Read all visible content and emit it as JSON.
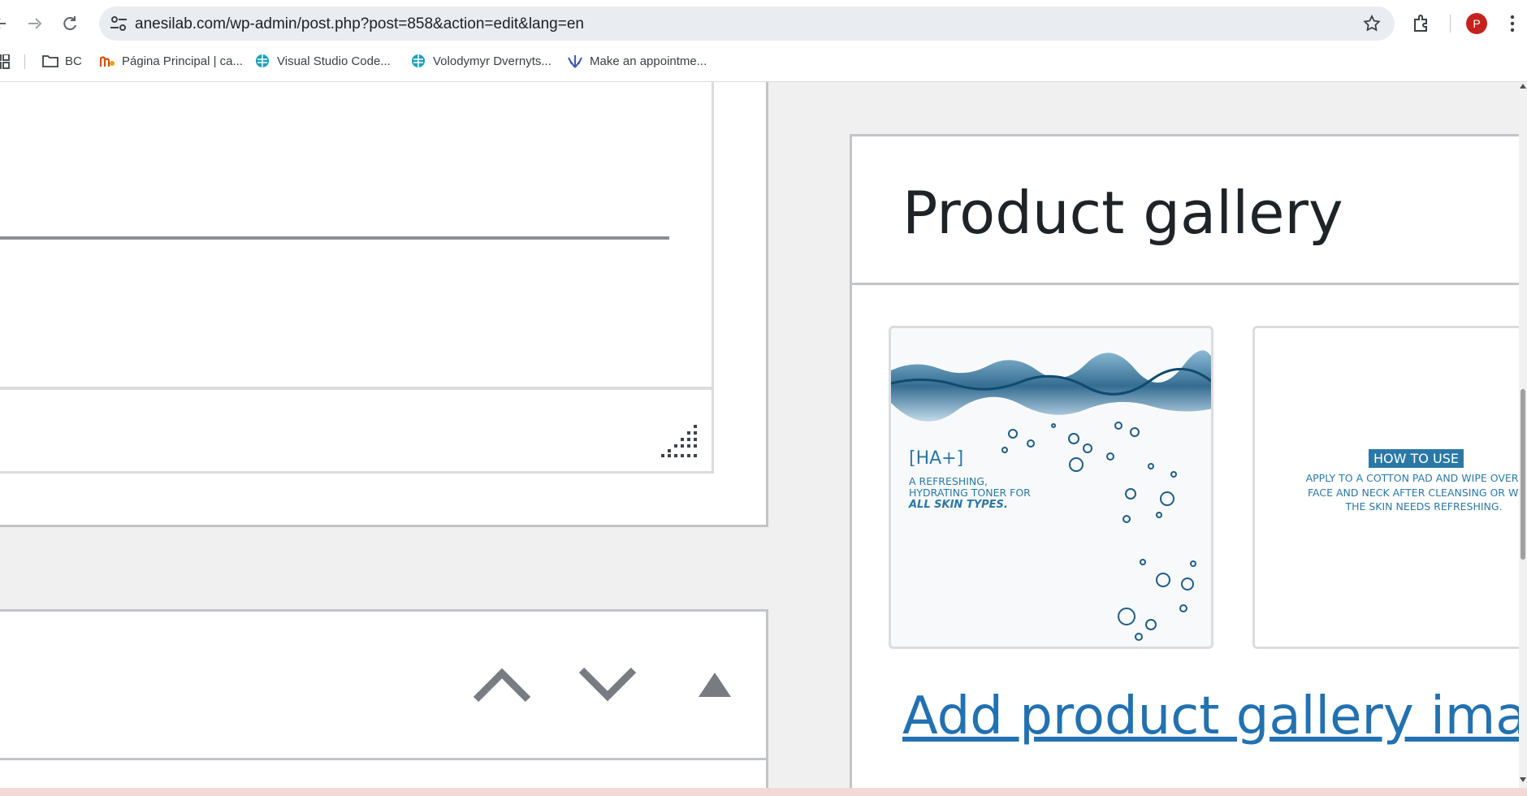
{
  "browser": {
    "url": "anesilab.com/wp-admin/post.php?post=858&action=edit&lang=en",
    "avatar_letter": "P",
    "bookmarks": [
      {
        "label": "BC",
        "icon": "folder-icon"
      },
      {
        "label": "Página Principal | ca...",
        "icon": "site-icon"
      },
      {
        "label": "Visual Studio Code...",
        "icon": "teal-globe-icon"
      },
      {
        "label": "Volodymyr Dvernyts...",
        "icon": "teal-globe-icon"
      },
      {
        "label": "Make an appointme...",
        "icon": "hand-icon"
      }
    ]
  },
  "gallery": {
    "title": "Product gallery",
    "add_link": "Add product gallery images",
    "image1": {
      "heading": "[HA+]",
      "line1": "A REFRESHING,",
      "line2": "HYDRATING TONER FOR",
      "line3": "ALL SKIN TYPES."
    },
    "image2": {
      "badge": "HOW TO USE",
      "text": "APPLY TO A COTTON PAD AND WIPE OVER THE FACE AND NECK AFTER CLEANSING OR WHEN THE SKIN NEEDS REFRESHING."
    }
  },
  "colors": {
    "accent": "#2271b1",
    "border": "#c3c4c7",
    "toner_blue": "#2b78a6"
  }
}
